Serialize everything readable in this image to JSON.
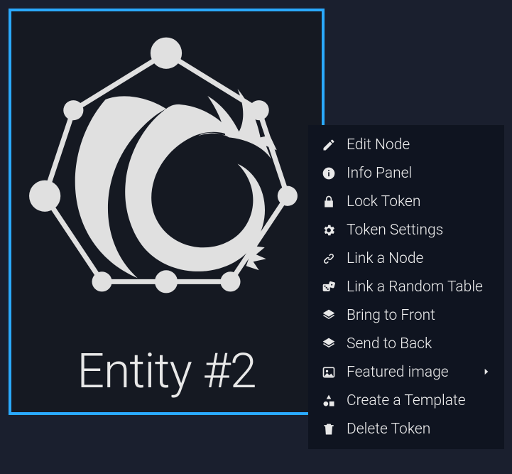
{
  "token": {
    "label": "Entity #2",
    "selected": true,
    "border_color": "#2aa9ff"
  },
  "context_menu": {
    "items": [
      {
        "icon": "edit-icon",
        "label": "Edit Node",
        "submenu": false
      },
      {
        "icon": "info-icon",
        "label": "Info Panel",
        "submenu": false
      },
      {
        "icon": "lock-icon",
        "label": "Lock Token",
        "submenu": false
      },
      {
        "icon": "gear-icon",
        "label": "Token Settings",
        "submenu": false
      },
      {
        "icon": "link-icon",
        "label": "Link a Node",
        "submenu": false
      },
      {
        "icon": "dice-icon",
        "label": "Link a Random Table",
        "submenu": false
      },
      {
        "icon": "layers-icon",
        "label": "Bring to Front",
        "submenu": false
      },
      {
        "icon": "layers-icon",
        "label": "Send to Back",
        "submenu": false
      },
      {
        "icon": "image-icon",
        "label": "Featured image",
        "submenu": true
      },
      {
        "icon": "shapes-icon",
        "label": "Create a Template",
        "submenu": false
      },
      {
        "icon": "trash-icon",
        "label": "Delete Token",
        "submenu": false
      }
    ]
  }
}
